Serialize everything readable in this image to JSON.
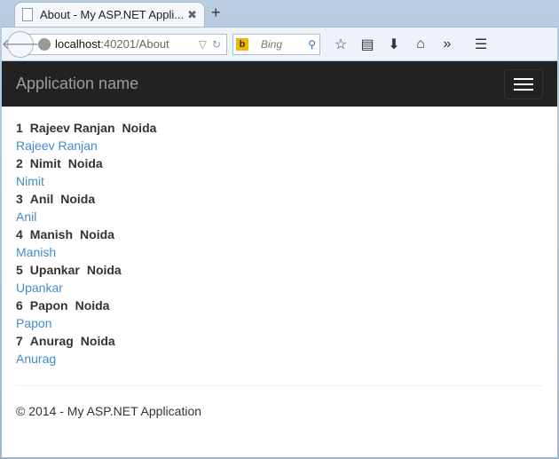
{
  "browser": {
    "tab_title": "About - My ASP.NET Appli...",
    "url_host": "localhost",
    "url_path": ":40201/About",
    "search_placeholder": "Bing"
  },
  "navbar": {
    "brand": "Application name"
  },
  "people": [
    {
      "id": "1",
      "name": "Rajeev Ranjan",
      "city": "Noida"
    },
    {
      "id": "2",
      "name": "Nimit",
      "city": "Noida"
    },
    {
      "id": "3",
      "name": "Anil",
      "city": "Noida"
    },
    {
      "id": "4",
      "name": "Manish",
      "city": "Noida"
    },
    {
      "id": "5",
      "name": "Upankar",
      "city": "Noida"
    },
    {
      "id": "6",
      "name": "Papon",
      "city": "Noida"
    },
    {
      "id": "7",
      "name": "Anurag",
      "city": "Noida"
    }
  ],
  "footer": {
    "text": "© 2014 - My ASP.NET Application"
  }
}
